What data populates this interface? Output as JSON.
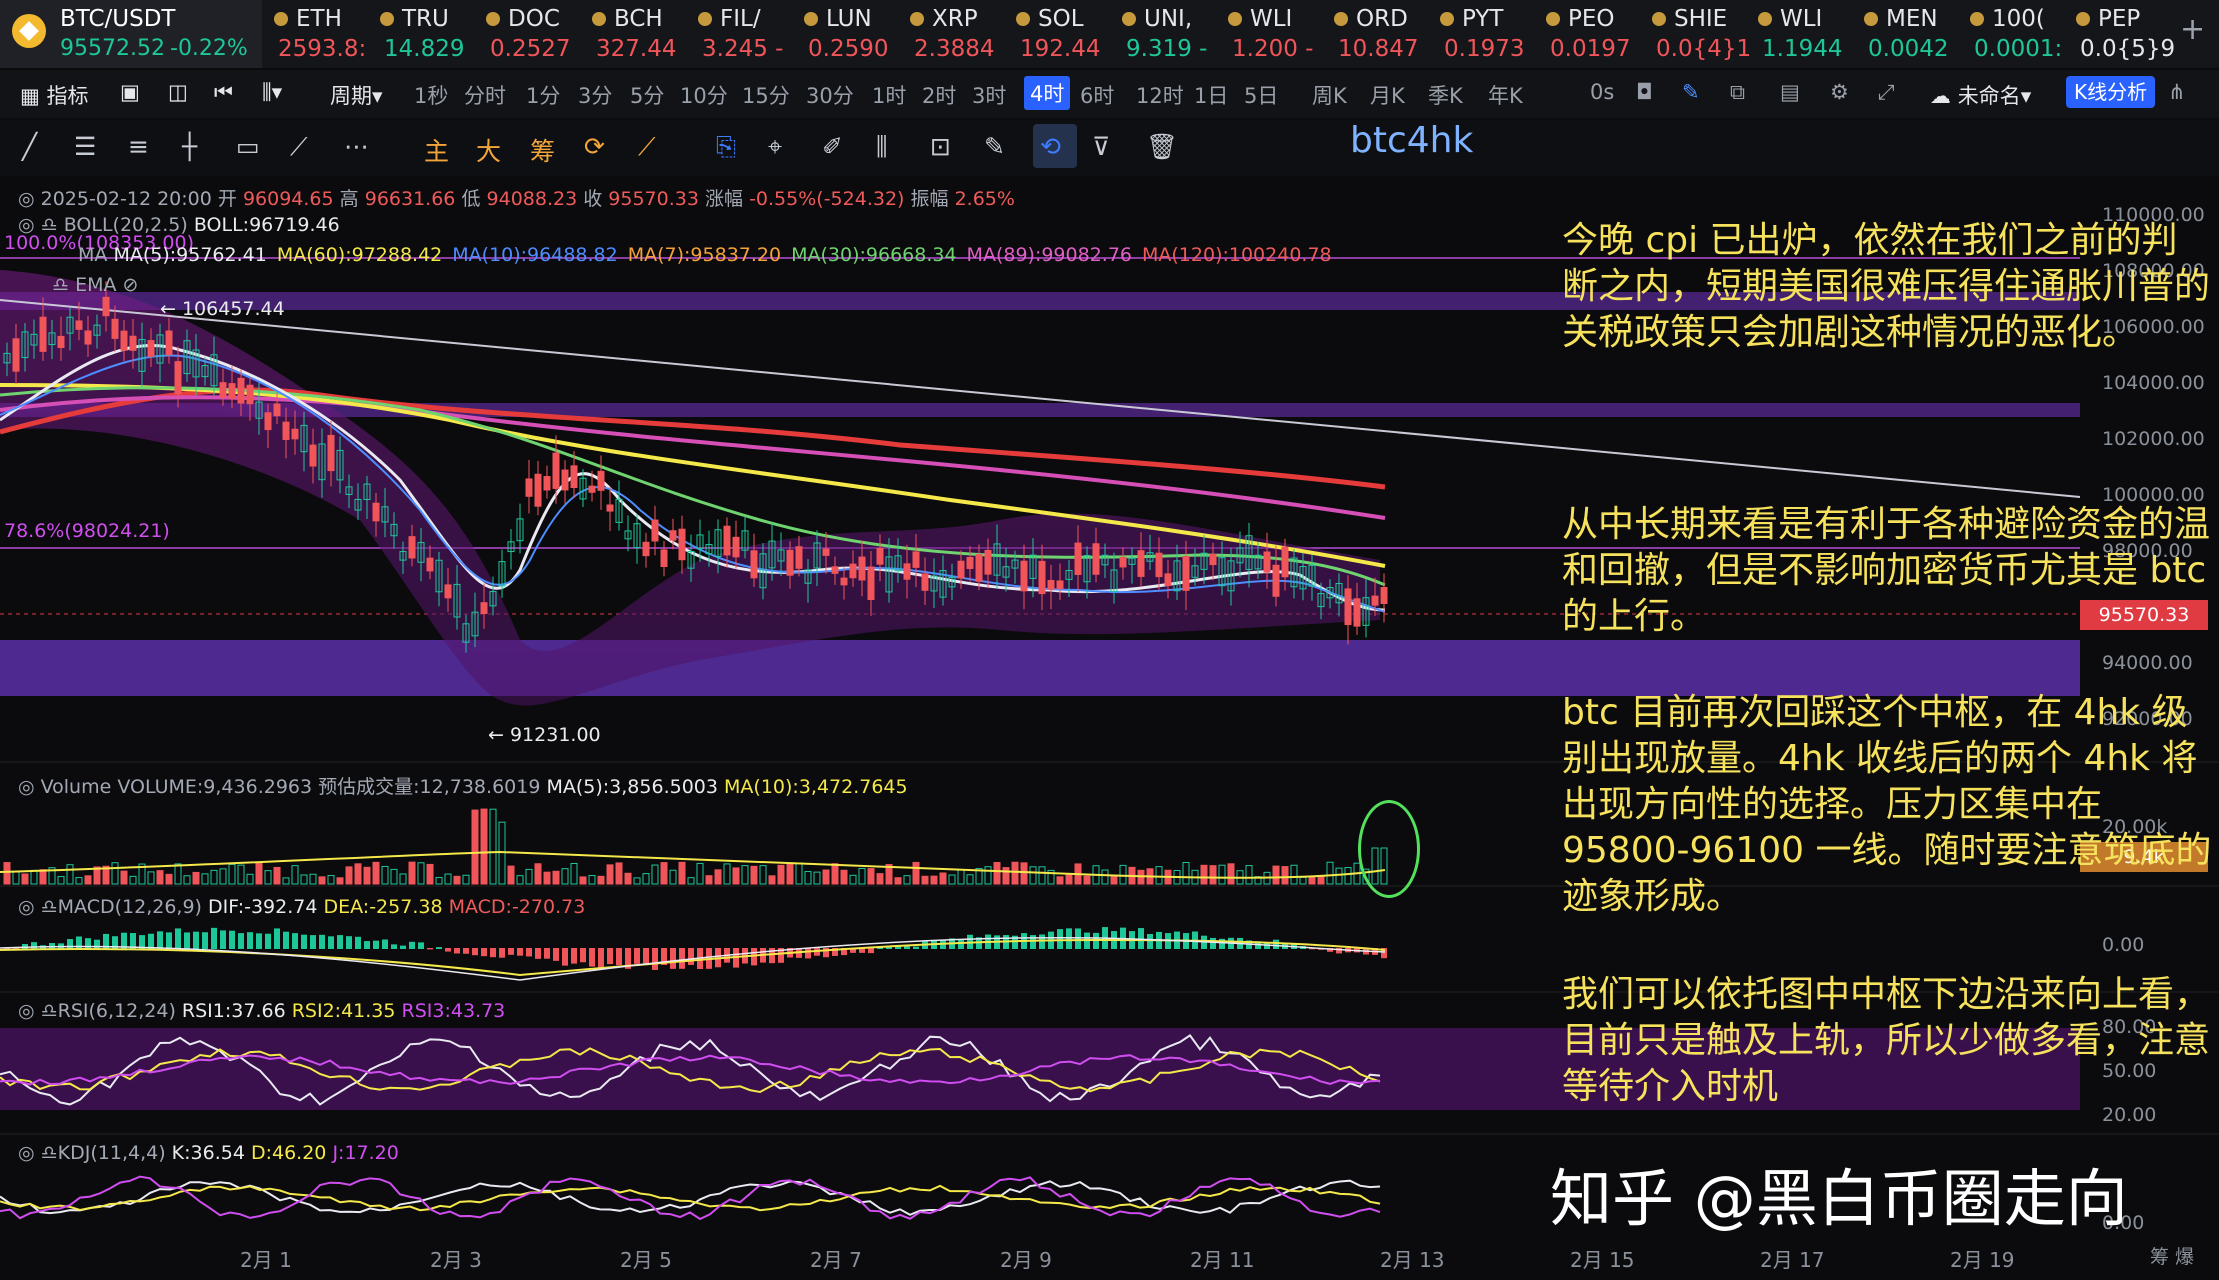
{
  "pair": {
    "name": "BTC/USDT",
    "price": "95572.52",
    "change": "-0.22%"
  },
  "tickers": [
    {
      "name": "ETH",
      "price": "2593.8:",
      "dir": "down"
    },
    {
      "name": "TRU",
      "price": "14.829",
      "dir": "up"
    },
    {
      "name": "DOC",
      "price": "0.2527",
      "dir": "down"
    },
    {
      "name": "BCH",
      "price": "327.44",
      "dir": "down"
    },
    {
      "name": "FIL/",
      "price": "3.245 -",
      "dir": "down"
    },
    {
      "name": "LUN",
      "price": "0.2590",
      "dir": "down"
    },
    {
      "name": "XRP",
      "price": "2.3884",
      "dir": "down"
    },
    {
      "name": "SOL",
      "price": "192.44",
      "dir": "down"
    },
    {
      "name": "UNI,",
      "price": "9.319 -",
      "dir": "up"
    },
    {
      "name": "WLI",
      "price": "1.200 -",
      "dir": "down"
    },
    {
      "name": "ORD",
      "price": "10.847",
      "dir": "down"
    },
    {
      "name": "PYT",
      "price": "0.1973",
      "dir": "down"
    },
    {
      "name": "PEO",
      "price": "0.0197",
      "dir": "down"
    },
    {
      "name": "SHIE",
      "price": "0.0{4}1",
      "dir": "down"
    },
    {
      "name": "WLI",
      "price": "1.1944",
      "dir": "up"
    },
    {
      "name": "MEN",
      "price": "0.0042",
      "dir": "up"
    },
    {
      "name": "100(",
      "price": "0.0001:",
      "dir": "up"
    },
    {
      "name": "PEP",
      "price": "0.0{5}9",
      "dir": "neutral"
    }
  ],
  "toolbar": {
    "indicator": "指标",
    "period": "周期",
    "periods": [
      "1秒",
      "分时",
      "1分",
      "3分",
      "5分",
      "10分",
      "15分",
      "30分",
      "1时",
      "2时",
      "3时",
      "4时",
      "6时",
      "12时",
      "1日",
      "5日",
      "周K",
      "月K",
      "季K",
      "年K"
    ],
    "active_period": "4时",
    "delay": "0s",
    "layout_name": "未命名",
    "kline_analysis": "K线分析"
  },
  "draw_tools": {
    "main": "主",
    "big": "大",
    "chips": "筹"
  },
  "chart_title": "btc4hk",
  "candle_info": {
    "date": "2025-02-12 20:00",
    "open_label": "开",
    "open": "96094.65",
    "high_label": "高",
    "high": "96631.66",
    "low_label": "低",
    "low": "94088.23",
    "close_label": "收",
    "close": "95570.33",
    "chg_label": "涨幅",
    "chg": "-0.55%(-524.32)",
    "amp_label": "振幅",
    "amp": "2.65%"
  },
  "indicators": {
    "boll": "BOLL(20,2.5)",
    "boll_val": "BOLL:96719.46",
    "ma_label": "MA",
    "ma": [
      {
        "t": "MA(5):95762.41",
        "c": "white"
      },
      {
        "t": "MA(60):97288.42",
        "c": "yel"
      },
      {
        "t": "MA(10):96488.82",
        "c": "blue"
      },
      {
        "t": "MA(7):95837.20",
        "c": "ora"
      },
      {
        "t": "MA(30):96668.34",
        "c": "grn"
      },
      {
        "t": "MA(89):99082.76",
        "c": "pink"
      },
      {
        "t": "MA(120):100240.78",
        "c": "red"
      }
    ],
    "ema": "EMA",
    "fib100": "100.0%(108353.00)",
    "fib786": "78.6%(98024.21)",
    "high_mark": "← 106457.44",
    "low_mark": "← 91231.00"
  },
  "volume": {
    "label": "Volume",
    "vol": "VOLUME:9,436.2963",
    "est": "预估成交量:12,738.6019",
    "ma5": "MA(5):3,856.5003",
    "ma10": "MA(10):3,472.7645",
    "tag": "9.4k",
    "axis": "20.00k"
  },
  "macd": {
    "label": "MACD(12,26,9)",
    "dif": "DIF:-392.74",
    "dea": "DEA:-257.38",
    "macd": "MACD:-270.73",
    "axis": "0.00"
  },
  "rsi": {
    "label": "RSI(6,12,24)",
    "rsi1": "RSI1:37.66",
    "rsi2": "RSI2:41.35",
    "rsi3": "RSI3:43.73",
    "axis": [
      "80.00",
      "50.00",
      "20.00"
    ]
  },
  "kdj": {
    "label": "KDJ(11,4,4)",
    "k": "K:36.54",
    "d": "D:46.20",
    "j": "J:17.20",
    "axis": "0.00"
  },
  "price_axis": [
    "110000.00",
    "108000.00",
    "106000.00",
    "104000.00",
    "102000.00",
    "100000.00",
    "98000.00",
    "95570.33",
    "94000.00",
    "92000.00"
  ],
  "last_price_tag": "95570.33",
  "x_dates": [
    "2月 1",
    "2月 3",
    "2月 5",
    "2月 7",
    "2月 9",
    "2月 11",
    "2月 13",
    "2月 15",
    "2月 17",
    "2月 19"
  ],
  "notes": [
    "今晚 cpi 已出炉，依然在我们之前的判断之内，短期美国很难压得住通胀川普的关税政策只会加剧这种情况的恶化。",
    "从中长期来看是有利于各种避险资金的温和回撤，但是不影响加密货币尤其是 btc 的上行。",
    "btc 目前再次回踩这个中枢，在 4hk 级别出现放量。4hk 收线后的两个 4hk 将出现方向性的选择。压力区集中在 95800-96100 一线。随时要注意筑底的迹象形成。",
    "我们可以依托图中中枢下边沿来向上看，目前只是触及上轨，所以少做多看，注意等待介入时机"
  ],
  "watermark": "知乎 @黑白币圈走向",
  "corner": "筹 爆",
  "colors": {
    "up": "#1ec79a",
    "down": "#f0555a",
    "accent": "#2a62ff",
    "note": "#f7e25d"
  }
}
